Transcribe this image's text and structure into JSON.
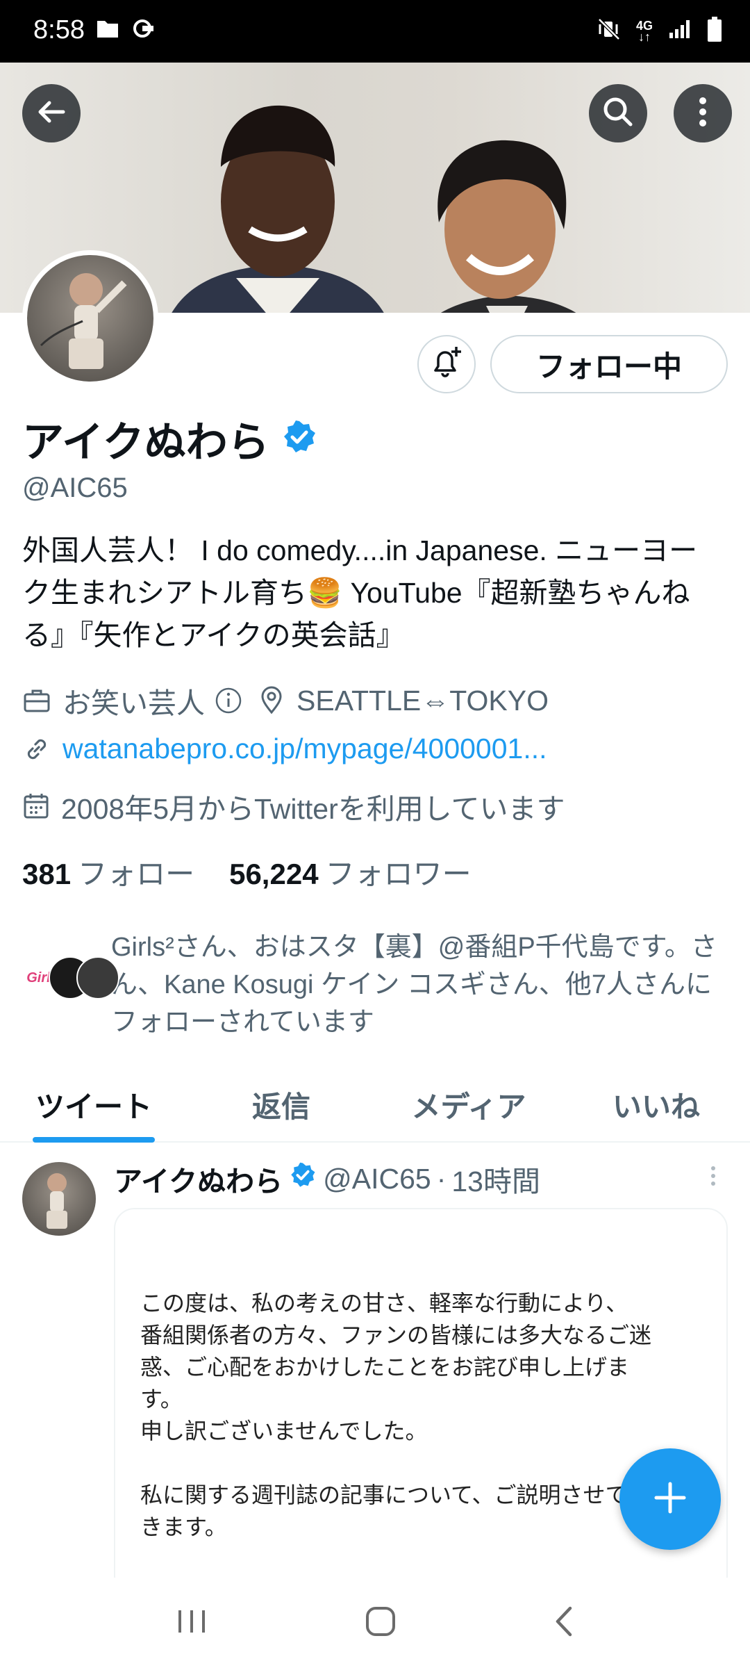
{
  "status_bar": {
    "time": "8:58",
    "left_icons": [
      "folder-icon",
      "cast-icon"
    ],
    "right_icons": [
      "mute-vibrate-icon",
      "4g-icon",
      "signal-icon",
      "battery-icon"
    ],
    "network": "4G"
  },
  "header": {
    "back_icon": "arrow-left-icon",
    "search_icon": "search-icon",
    "more_icon": "more-vertical-icon"
  },
  "profile": {
    "name": "アイクぬわら",
    "verified": true,
    "handle": "@AIC65",
    "bio": "外国人芸人！ I do comedy....in Japanese.  ニューヨーク生まれシアトル育ち🍔 YouTube『超新塾ちゃんねる』『矢作とアイクの英会話』",
    "category": "お笑い芸人",
    "location": "SEATTLE⇔TOKYO",
    "website": "watanabepro.co.jp/mypage/4000001...",
    "joined": "2008年5月からTwitterを利用しています",
    "following_count": "381",
    "following_label": "フォロー",
    "followers_count": "56,224",
    "followers_label": "フォロワー",
    "follow_button": "フォロー中",
    "followed_by": "Girls²さん、おはスタ【裏】@番組P千代島です。さん、Kane Kosugi ケイン コスギさん、他7人さんにフォローされています",
    "followed_by_avatar_text": "Girls"
  },
  "tabs": [
    {
      "label": "ツイート",
      "active": true
    },
    {
      "label": "返信",
      "active": false
    },
    {
      "label": "メディア",
      "active": false
    },
    {
      "label": "いいね",
      "active": false
    }
  ],
  "tweet": {
    "name": "アイクぬわら",
    "handle": "@AIC65",
    "separator": "·",
    "time": "13時間",
    "image_text": "この度は、私の考えの甘さ、軽率な行動により、\n番組関係者の方々、ファンの皆様には多大なるご迷\n惑、ご心配をおかけしたことをお詫び申し上げま\nす。\n申し訳ございませんでした。\n\n私に関する週刊誌の記事について、ご説明させて頂\nきます。\n\n記事の中で、私の行為が条例違反、犯罪行為とされ"
  },
  "colors": {
    "accent": "#1d9bf0",
    "text_primary": "#0f1419",
    "text_secondary": "#536471",
    "border": "#cfd9de"
  }
}
